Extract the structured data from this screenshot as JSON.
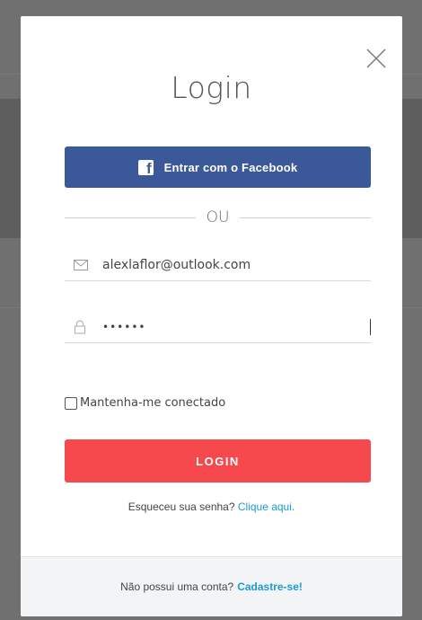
{
  "modal": {
    "title": "Login",
    "close_icon": "close-icon"
  },
  "facebook": {
    "label": "Entrar com o Facebook",
    "icon": "facebook-icon",
    "color": "#3b5998"
  },
  "divider": {
    "text": "OU"
  },
  "email": {
    "value": "alexlaflor@outlook.com",
    "icon": "envelope-icon"
  },
  "password": {
    "value": "••••••",
    "icon": "lock-icon"
  },
  "remember": {
    "label": "Mantenha-me conectado",
    "checked": false
  },
  "login_button": {
    "label": "LOGIN",
    "color": "#f5494d"
  },
  "forgot": {
    "text": "Esqueceu sua senha?",
    "link": "Clique aqui."
  },
  "footer": {
    "text": "Não possui uma conta?",
    "link": "Cadastre-se!"
  },
  "colors": {
    "link": "#1a9bd7"
  }
}
